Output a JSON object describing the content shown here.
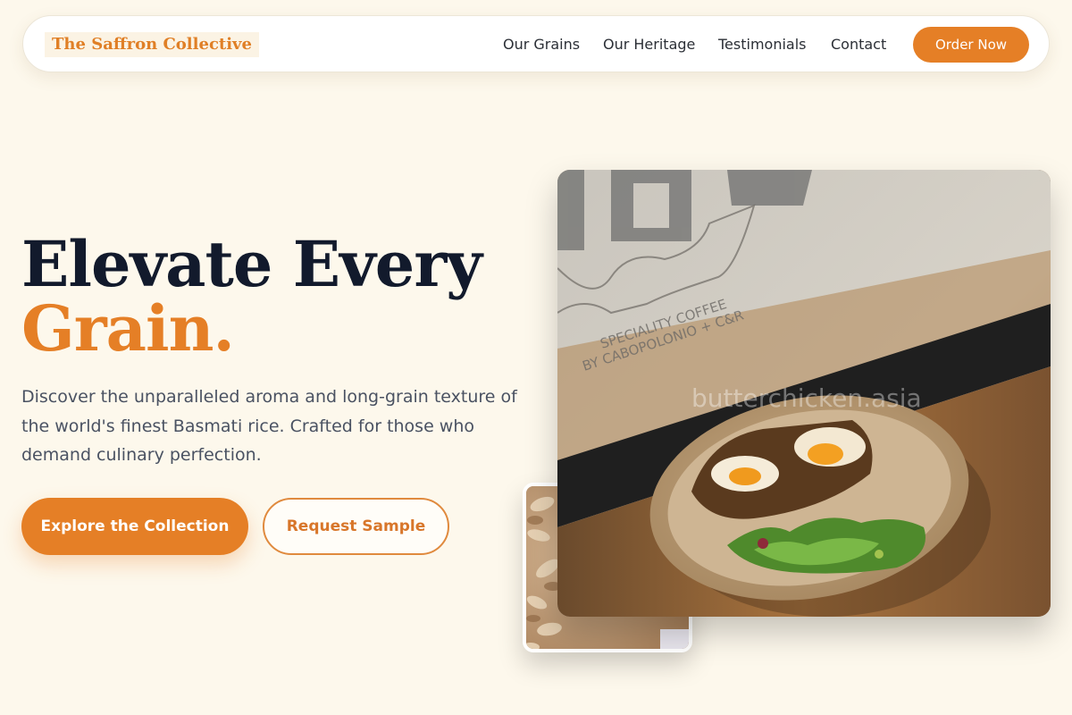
{
  "nav": {
    "brand": "The Saffron Collective",
    "links": [
      "Our Grains",
      "Our Heritage",
      "Testimonials",
      "Contact"
    ],
    "cta": "Order Now"
  },
  "hero": {
    "title_line1": "Elevate Every",
    "title_accent": "Grain.",
    "description": "Discover the unparalleled aroma and long-grain texture of the world's finest Basmati rice. Crafted for those who demand culinary perfection.",
    "primary_button": "Explore the Collection",
    "secondary_button": "Request Sample"
  },
  "images": {
    "main_alt": "Bowl of toast with egg and salad on a cafe window ledge",
    "small_alt": "Close-up of rice grains",
    "watermark": "butterchicken.asia",
    "window_text_line1": "SPECIALITY COFFEE",
    "window_text_line2": "BY CABOPOLONIO + C&R"
  },
  "colors": {
    "accent": "#e57f26",
    "background": "#fdf8ec",
    "heading": "#121a2c"
  }
}
